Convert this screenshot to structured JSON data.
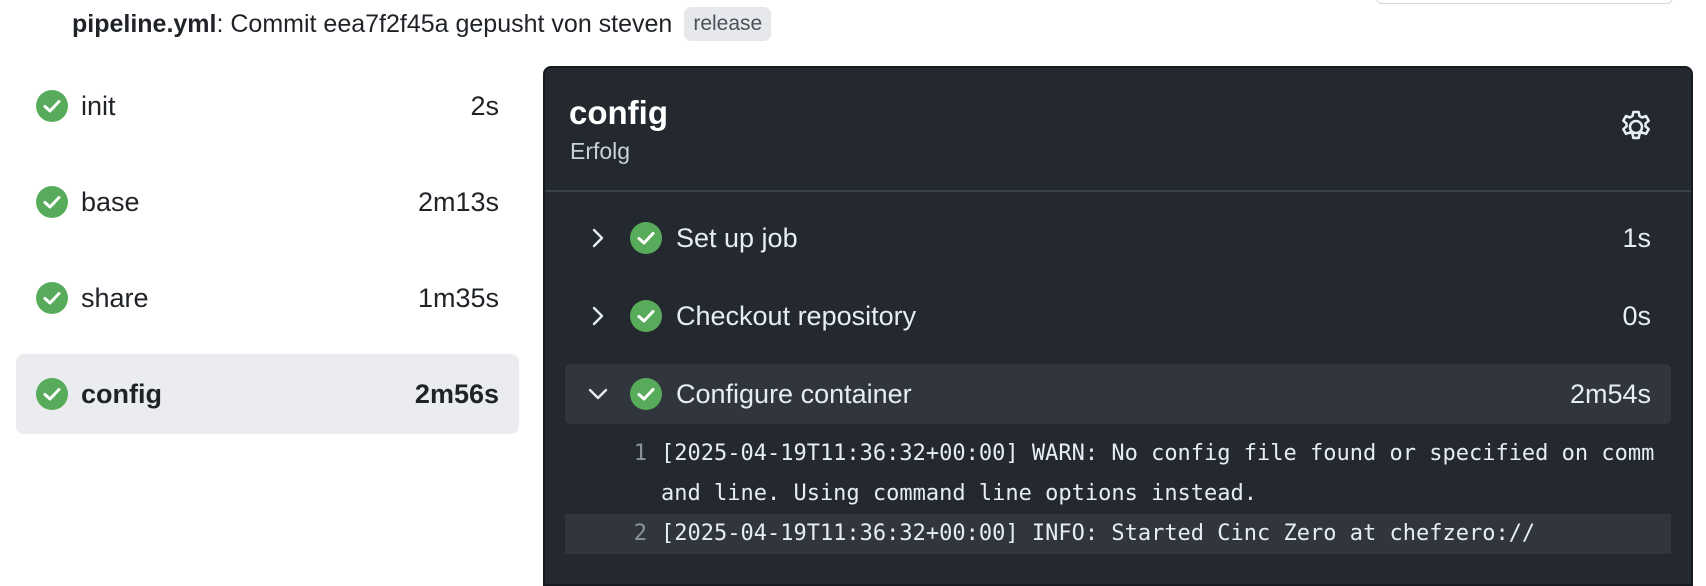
{
  "header": {
    "file": "pipeline.yml",
    "text": ": Commit eea7f2f45a gepusht von steven",
    "badge": "release"
  },
  "colors": {
    "success": "#57ab5a",
    "panel_bg": "#24292f",
    "active_bg": "#ebecef"
  },
  "jobs": [
    {
      "name": "init",
      "duration": "2s",
      "status_icon": "check-circle-icon"
    },
    {
      "name": "base",
      "duration": "2m13s",
      "status_icon": "check-circle-icon"
    },
    {
      "name": "share",
      "duration": "1m35s",
      "status_icon": "check-circle-icon"
    },
    {
      "name": "config",
      "duration": "2m56s",
      "status_icon": "check-circle-icon",
      "active": true
    }
  ],
  "panel": {
    "title": "config",
    "status": "Erfolg",
    "settings_icon": "gear-icon"
  },
  "steps": [
    {
      "name": "Set up job",
      "duration": "1s",
      "expanded": false
    },
    {
      "name": "Checkout repository",
      "duration": "0s",
      "expanded": false
    },
    {
      "name": "Configure container",
      "duration": "2m54s",
      "expanded": true
    }
  ],
  "log": [
    {
      "n": "1",
      "text": "[2025-04-19T11:36:32+00:00] WARN: No config file found or specified on command line. Using command line options instead."
    },
    {
      "n": "2",
      "text": "[2025-04-19T11:36:32+00:00] INFO: Started Cinc Zero at chefzero://"
    }
  ]
}
